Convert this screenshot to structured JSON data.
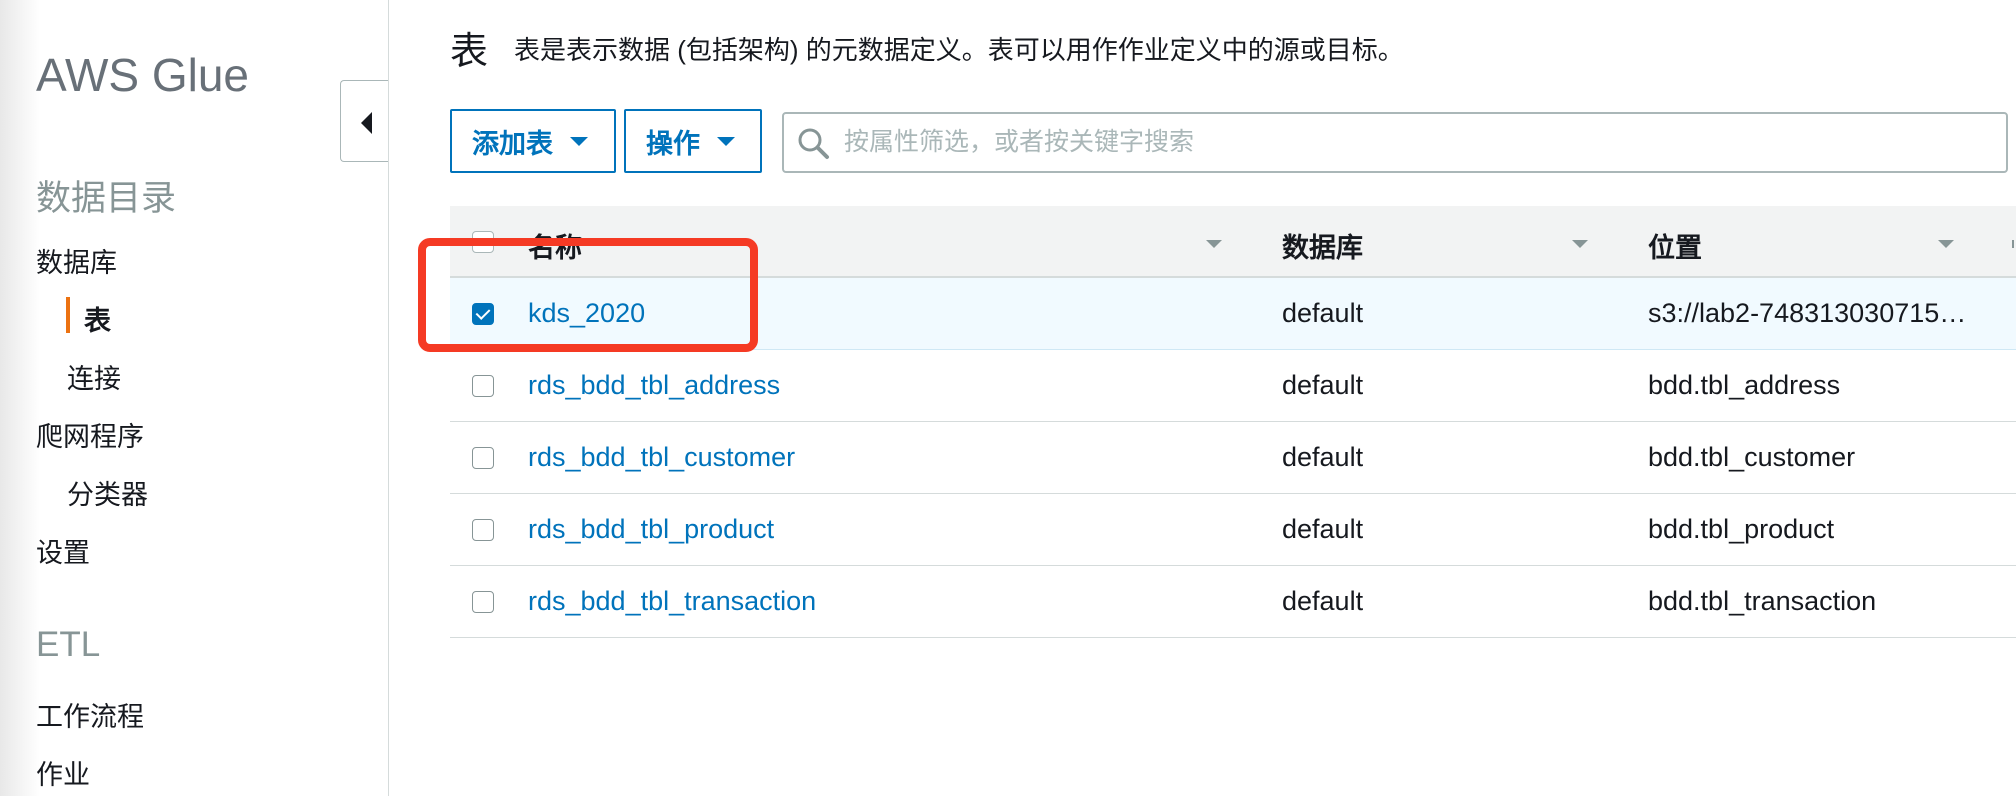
{
  "sidebar": {
    "brand": "AWS Glue",
    "collapse_label": "",
    "sections": [
      {
        "title": "数据目录",
        "items": [
          {
            "label": "数据库",
            "level": 1
          },
          {
            "label": "表",
            "level": 2,
            "active": true
          },
          {
            "label": "连接",
            "level": 2
          },
          {
            "label": "爬网程序",
            "level": 1
          },
          {
            "label": "分类器",
            "level": 2
          },
          {
            "label": "设置",
            "level": 1
          }
        ]
      },
      {
        "title": "ETL",
        "items": [
          {
            "label": "工作流程",
            "level": 1
          },
          {
            "label": "作业",
            "level": 1
          }
        ]
      }
    ]
  },
  "header": {
    "title": "表",
    "description": "表是表示数据 (包括架构) 的元数据定义。表可以用作作业定义中的源或目标。"
  },
  "toolbar": {
    "add_table_label": "添加表",
    "actions_label": "操作"
  },
  "search": {
    "placeholder": "按属性筛选，或者按关键字搜索",
    "value": "",
    "icon": "search-icon"
  },
  "table": {
    "columns": [
      "名称",
      "数据库",
      "位置"
    ],
    "rows": [
      {
        "name": "kds_2020",
        "database": "default",
        "location": "s3://lab2-748313030715…",
        "checked": true
      },
      {
        "name": "rds_bdd_tbl_address",
        "database": "default",
        "location": "bdd.tbl_address",
        "checked": false
      },
      {
        "name": "rds_bdd_tbl_customer",
        "database": "default",
        "location": "bdd.tbl_customer",
        "checked": false
      },
      {
        "name": "rds_bdd_tbl_product",
        "database": "default",
        "location": "bdd.tbl_product",
        "checked": false
      },
      {
        "name": "rds_bdd_tbl_transaction",
        "database": "default",
        "location": "bdd.tbl_transaction",
        "checked": false
      }
    ]
  },
  "colors": {
    "accent": "#0073bb",
    "active_indicator": "#ec7211",
    "highlight_box": "#f53a24",
    "selected_row": "#f1faff"
  }
}
